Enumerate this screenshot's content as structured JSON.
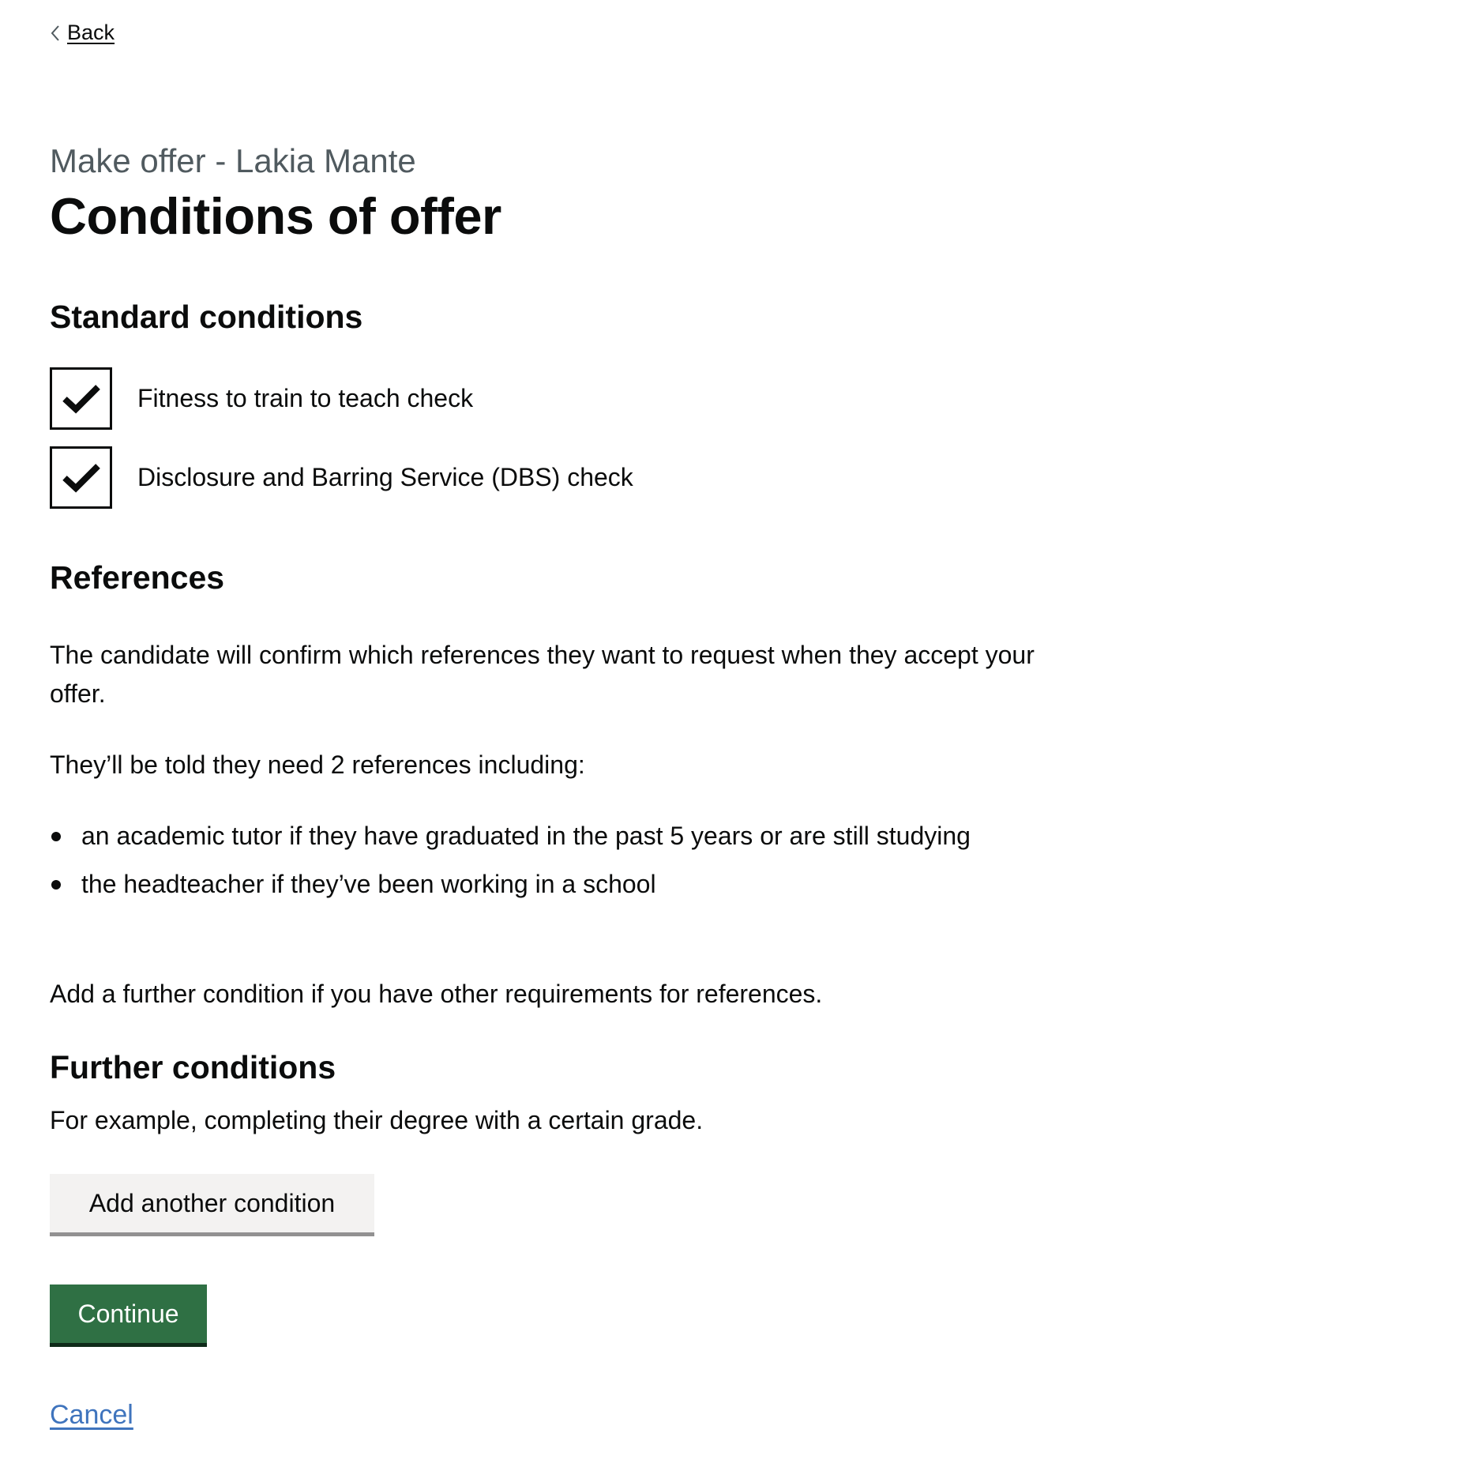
{
  "nav": {
    "back_label": "Back"
  },
  "header": {
    "caption": "Make offer - Lakia Mante",
    "title": "Conditions of offer"
  },
  "standard_conditions": {
    "heading": "Standard conditions",
    "items": [
      {
        "label": "Fitness to train to teach check",
        "checked": true
      },
      {
        "label": "Disclosure and Barring Service (DBS) check",
        "checked": true
      }
    ]
  },
  "references": {
    "heading": "References",
    "intro": "The candidate will confirm which references they want to request when they accept your offer.",
    "lead": "They’ll be told they need 2 references including:",
    "bullets": [
      "an academic tutor if they have graduated in the past 5 years or are still studying",
      "the headteacher if they’ve been working in a school"
    ],
    "footer": "Add a further condition if you have other requirements for references."
  },
  "further_conditions": {
    "heading": "Further conditions",
    "hint": "For example, completing their degree with a certain grade.",
    "add_button": "Add another condition"
  },
  "actions": {
    "continue_label": "Continue",
    "cancel_label": "Cancel"
  },
  "colors": {
    "primary_button": "#2f7044",
    "link": "#3f74bd",
    "caption": "#505a5f"
  }
}
